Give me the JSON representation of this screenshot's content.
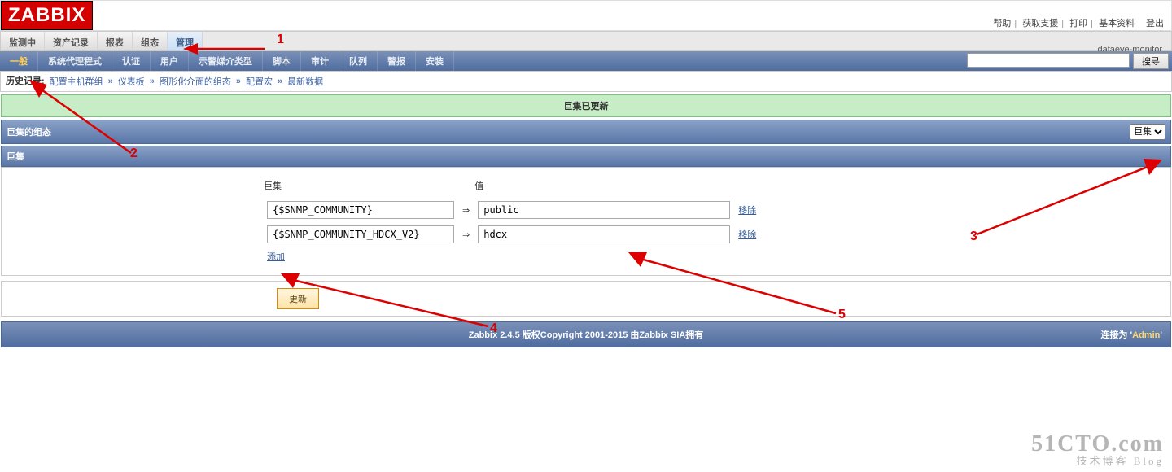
{
  "top_links": {
    "help": "帮助",
    "support": "获取支援",
    "print": "打印",
    "profile": "基本资料",
    "logout": "登出"
  },
  "logo_text": "ZABBIX",
  "host_label": "dataeye-monitor",
  "tabs1": [
    "监测中",
    "资产记录",
    "报表",
    "组态",
    "管理"
  ],
  "tabs1_active": 4,
  "tabs2": [
    "一般",
    "系统代理程式",
    "认证",
    "用户",
    "示警媒介类型",
    "脚本",
    "审计",
    "队列",
    "警报",
    "安装"
  ],
  "tabs2_active": 0,
  "search": {
    "placeholder": "",
    "button": "搜寻"
  },
  "history": {
    "label": "历史记录:",
    "items": [
      "配置主机群组",
      "仪表板",
      "图形化介面的组态",
      "配置宏",
      "最新数据"
    ]
  },
  "banner": "巨集已更新",
  "bar1": {
    "title": "巨集的组态",
    "dropdown": [
      "巨集"
    ],
    "selected": "巨集"
  },
  "bar2": {
    "title": "巨集"
  },
  "form": {
    "col1": "巨集",
    "col2": "值",
    "rows": [
      {
        "macro": "{$SNMP_COMMUNITY}",
        "value": "public",
        "remove": "移除"
      },
      {
        "macro": "{$SNMP_COMMUNITY_HDCX_V2}",
        "value": "hdcx",
        "remove": "移除"
      }
    ],
    "add": "添加"
  },
  "update_btn": "更新",
  "footer": {
    "text": "Zabbix 2.4.5 版权Copyright 2001-2015 由Zabbix SIA拥有",
    "right_pre": "连接为 '",
    "right_user": "Admin",
    "right_post": "'"
  },
  "watermark": {
    "big": "51CTO.com",
    "small": "技术博客   Blog"
  },
  "annotations": {
    "n1": "1",
    "n2": "2",
    "n3": "3",
    "n4": "4",
    "n5": "5"
  }
}
